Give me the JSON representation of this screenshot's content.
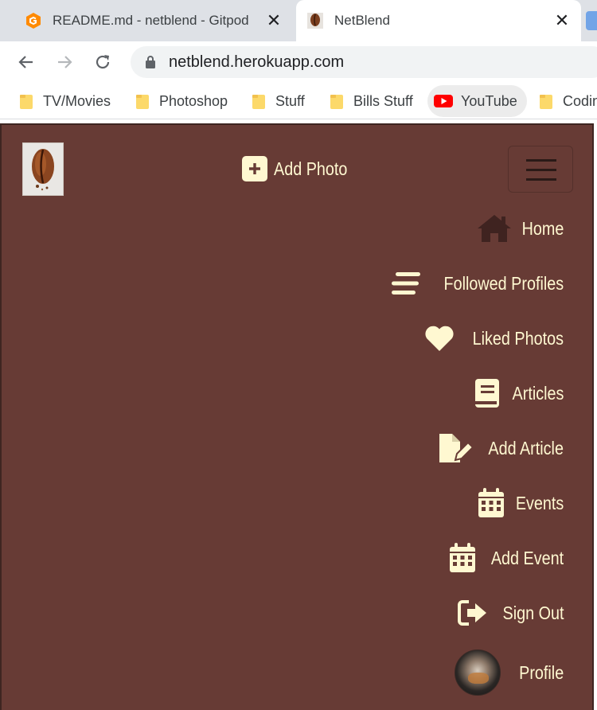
{
  "browser": {
    "tabs": [
      {
        "title": "README.md - netblend - Gitpod",
        "favicon": "gitpod-icon",
        "active": false
      },
      {
        "title": "NetBlend",
        "favicon": "coffee-bean-icon",
        "active": true
      }
    ],
    "url": "netblend.herokuapp.com",
    "bookmarks": [
      {
        "label": "TV/Movies",
        "icon": "folder-icon"
      },
      {
        "label": "Photoshop",
        "icon": "folder-icon"
      },
      {
        "label": "Stuff",
        "icon": "folder-icon"
      },
      {
        "label": "Bills Stuff",
        "icon": "folder-icon"
      },
      {
        "label": "YouTube",
        "icon": "youtube-icon"
      },
      {
        "label": "Codin",
        "icon": "folder-icon"
      }
    ]
  },
  "navbar": {
    "add_photo": "Add Photo",
    "items": [
      {
        "label": "Home",
        "icon": "home-icon"
      },
      {
        "label": "Followed Profiles",
        "icon": "stream-icon"
      },
      {
        "label": "Liked Photos",
        "icon": "heart-icon"
      },
      {
        "label": "Articles",
        "icon": "book-icon"
      },
      {
        "label": "Add Article",
        "icon": "file-pen-icon"
      },
      {
        "label": "Events",
        "icon": "calendar-icon"
      },
      {
        "label": "Add Event",
        "icon": "calendar-icon"
      },
      {
        "label": "Sign Out",
        "icon": "sign-out-icon"
      },
      {
        "label": "Profile",
        "icon": "avatar"
      }
    ]
  },
  "colors": {
    "navbar_bg": "#673b35",
    "nav_text": "#fff8d1",
    "home_icon": "#3f2320"
  }
}
